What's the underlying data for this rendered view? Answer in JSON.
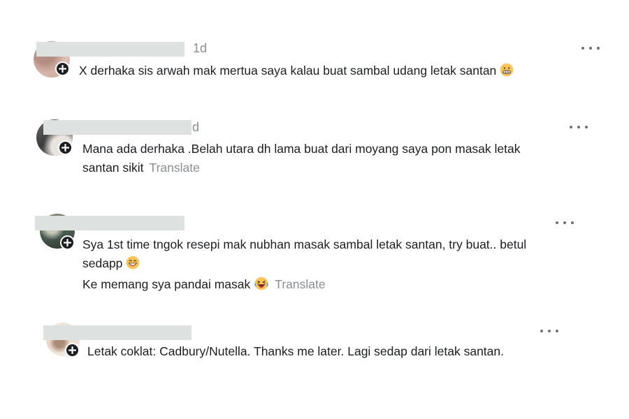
{
  "comments": [
    {
      "time": "1d",
      "lines": [
        "X derhaka sis arwah mak mertua saya kalau buat sambal udang letak santan"
      ],
      "emoji": "grimacing-face-icon"
    },
    {
      "time": "d",
      "lines": [
        "Mana ada derhaka .Belah utara dh lama buat dari moyang saya pon masak letak",
        "santan sikit"
      ],
      "translate": "Translate"
    },
    {
      "lines": [
        "Sya 1st time tngok resepi mak nubhan masak sambal letak santan, try buat.. betul",
        "sedapp",
        "Ke memang sya pandai masak"
      ],
      "emoji": [
        "grinning-face-icon",
        "laughing-face-icon"
      ],
      "translate": "Translate"
    },
    {
      "lines": [
        "Letak coklat: Cadbury/Nutella. Thanks me later. Lagi sedap dari letak santan."
      ]
    }
  ]
}
